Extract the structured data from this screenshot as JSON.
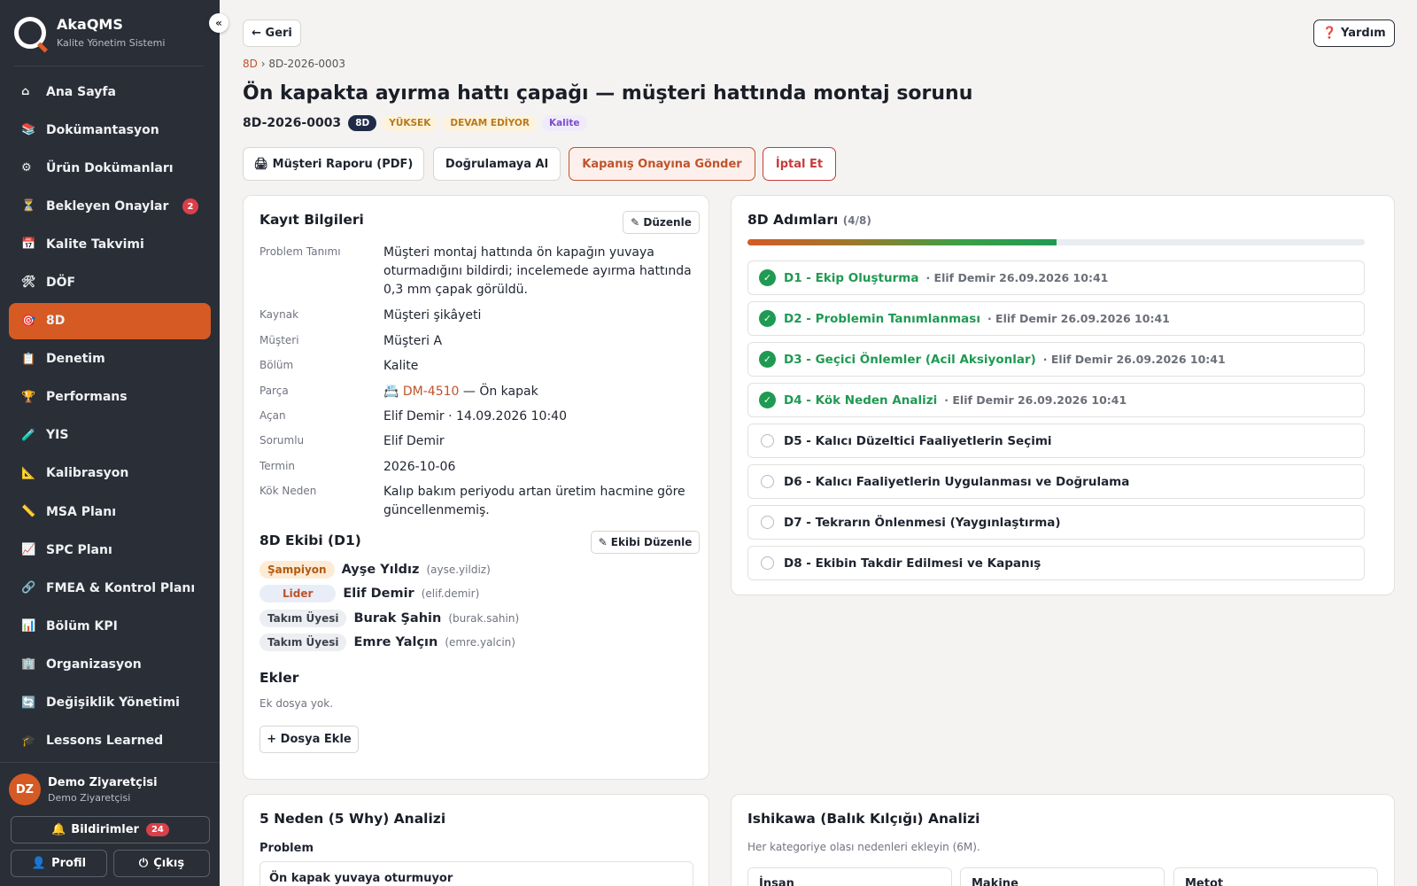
{
  "app": {
    "name": "AkaQMS",
    "subtitle": "Kalite Yönetim Sistemi",
    "collapse": "«"
  },
  "nav": [
    {
      "icon": "⌂",
      "label": "Ana Sayfa"
    },
    {
      "icon": "📚",
      "label": "Dokümantasyon"
    },
    {
      "icon": "⚙",
      "label": "Ürün Dokümanları"
    },
    {
      "icon": "⏳",
      "label": "Bekleyen Onaylar",
      "badge": "2"
    },
    {
      "icon": "📅",
      "label": "Kalite Takvimi"
    },
    {
      "icon": "🛠",
      "label": "DÖF"
    },
    {
      "icon": "🎯",
      "label": "8D"
    },
    {
      "icon": "📋",
      "label": "Denetim"
    },
    {
      "icon": "🏆",
      "label": "Performans"
    },
    {
      "icon": "🧪",
      "label": "YIS"
    },
    {
      "icon": "📐",
      "label": "Kalibrasyon"
    },
    {
      "icon": "📏",
      "label": "MSA Planı"
    },
    {
      "icon": "📈",
      "label": "SPC Planı"
    },
    {
      "icon": "🔗",
      "label": "FMEA & Kontrol Planı"
    },
    {
      "icon": "📊",
      "label": "Bölüm KPI"
    },
    {
      "icon": "🏢",
      "label": "Organizasyon"
    },
    {
      "icon": "🔄",
      "label": "Değişiklik Yönetimi"
    },
    {
      "icon": "🎓",
      "label": "Lessons Learned"
    }
  ],
  "user": {
    "initials": "DZ",
    "name": "Demo Ziyaretçisi",
    "role": "Demo Ziyaretçisi"
  },
  "footer": {
    "notifications": "Bildirimler",
    "notif_count": "24",
    "bell": "🔔",
    "profile": "Profil",
    "profile_icon": "👤",
    "logout": "Çıkış",
    "logout_icon": "⏻"
  },
  "header": {
    "back": "← Geri",
    "help": "❓ Yardım"
  },
  "breadcrumb": {
    "root": "8D",
    "sep": "›",
    "current": "8D-2026-0003"
  },
  "record": {
    "title": "Ön kapakta ayırma hattı çapağı — müşteri hattında montaj sorunu",
    "id": "8D-2026-0003",
    "badges": [
      {
        "text": "8D",
        "bg": "#1f2b47",
        "fg": "#ffffff"
      },
      {
        "text": "YÜKSEK",
        "bg": "#fdf3dc",
        "fg": "#b7791f"
      },
      {
        "text": "DEVAM EDİYOR",
        "bg": "#fdf3dc",
        "fg": "#b7791f"
      },
      {
        "text": "Kalite",
        "bg": "#f0ebfb",
        "fg": "#7c4dca"
      }
    ]
  },
  "actions": {
    "report": "🖨 Müşteri Raporu (PDF)",
    "verify": "Doğrulamaya Al",
    "send": "Kapanış Onayına Gönder",
    "cancel": "İptal Et"
  },
  "info": {
    "title": "Kayıt Bilgileri",
    "edit": "✎ Düzenle",
    "fields": [
      {
        "k": "Problem Tanımı",
        "v": "Müşteri montaj hattında ön kapağın yuvaya oturmadığını bildirdi; incelemede ayırma hattında 0,3 mm çapak görüldü."
      },
      {
        "k": "Kaynak",
        "v": "Müşteri şikâyeti"
      },
      {
        "k": "Müşteri",
        "v": "Müşteri A"
      },
      {
        "k": "Bölüm",
        "v": "Kalite"
      },
      {
        "k": "Parça",
        "v": "— Ön kapak",
        "icon": "📇",
        "link": "DM-4510"
      },
      {
        "k": "Açan",
        "v": "Elif Demir · 14.09.2026 10:40"
      },
      {
        "k": "Sorumlu",
        "v": "Elif Demir"
      },
      {
        "k": "Termin",
        "v": "2026-10-06"
      },
      {
        "k": "Kök Neden",
        "v": "Kalıp bakım periyodu artan üretim hacmine göre güncellenmemiş."
      }
    ]
  },
  "team": {
    "title": "8D Ekibi (D1)",
    "edit": "✎ Ekibi Düzenle",
    "members": [
      {
        "role": "Şampiyon",
        "name": "Ayşe Yıldız",
        "user": "(ayse.yildiz)",
        "bg": "#fdebd6",
        "fg": "#b35a12"
      },
      {
        "role": "Lider",
        "name": "Elif Demir",
        "user": "(elif.demir)",
        "bg": "#e8edf7",
        "fg": "#c0532a"
      },
      {
        "role": "Takım Üyesi",
        "name": "Burak Şahin",
        "user": "(burak.sahin)",
        "bg": "#eceef1",
        "fg": "#3c414b"
      },
      {
        "role": "Takım Üyesi",
        "name": "Emre Yalçın",
        "user": "(emre.yalcin)",
        "bg": "#eceef1",
        "fg": "#3c414b"
      }
    ]
  },
  "attachments": {
    "title": "Ekler",
    "empty": "Ek dosya yok.",
    "add": "+ Dosya Ekle"
  },
  "steps": {
    "title": "8D Adımları",
    "count": "(4/8)",
    "progress": 0.5,
    "items": [
      {
        "label": "D1 - Ekip Oluşturma",
        "meta": "· Elif Demir 26.09.2026 10:41",
        "done": true
      },
      {
        "label": "D2 - Problemin Tanımlanması",
        "meta": "· Elif Demir 26.09.2026 10:41",
        "done": true
      },
      {
        "label": "D3 - Geçici Önlemler (Acil Aksiyonlar)",
        "meta": "· Elif Demir 26.09.2026 10:41",
        "done": true
      },
      {
        "label": "D4 - Kök Neden Analizi",
        "meta": "· Elif Demir 26.09.2026 10:41",
        "done": true
      },
      {
        "label": "D5 - Kalıcı Düzeltici Faaliyetlerin Seçimi",
        "meta": "",
        "done": false
      },
      {
        "label": "D6 - Kalıcı Faaliyetlerin Uygulanması ve Doğrulama",
        "meta": "",
        "done": false
      },
      {
        "label": "D7 - Tekrarın Önlenmesi (Yaygınlaştırma)",
        "meta": "",
        "done": false
      },
      {
        "label": "D8 - Ekibin Takdir Edilmesi ve Kapanış",
        "meta": "",
        "done": false
      }
    ]
  },
  "why": {
    "title": "5 Neden (5 Why) Analizi",
    "problem_label": "Problem",
    "problem_value": "Ön kapak yuvaya oturmuyor"
  },
  "ishikawa": {
    "title": "Ishikawa (Balık Kılçığı) Analizi",
    "hint": "Her kategoriye olası nedenleri ekleyin (6M).",
    "categories": [
      "İnsan",
      "Makine",
      "Metot"
    ]
  }
}
